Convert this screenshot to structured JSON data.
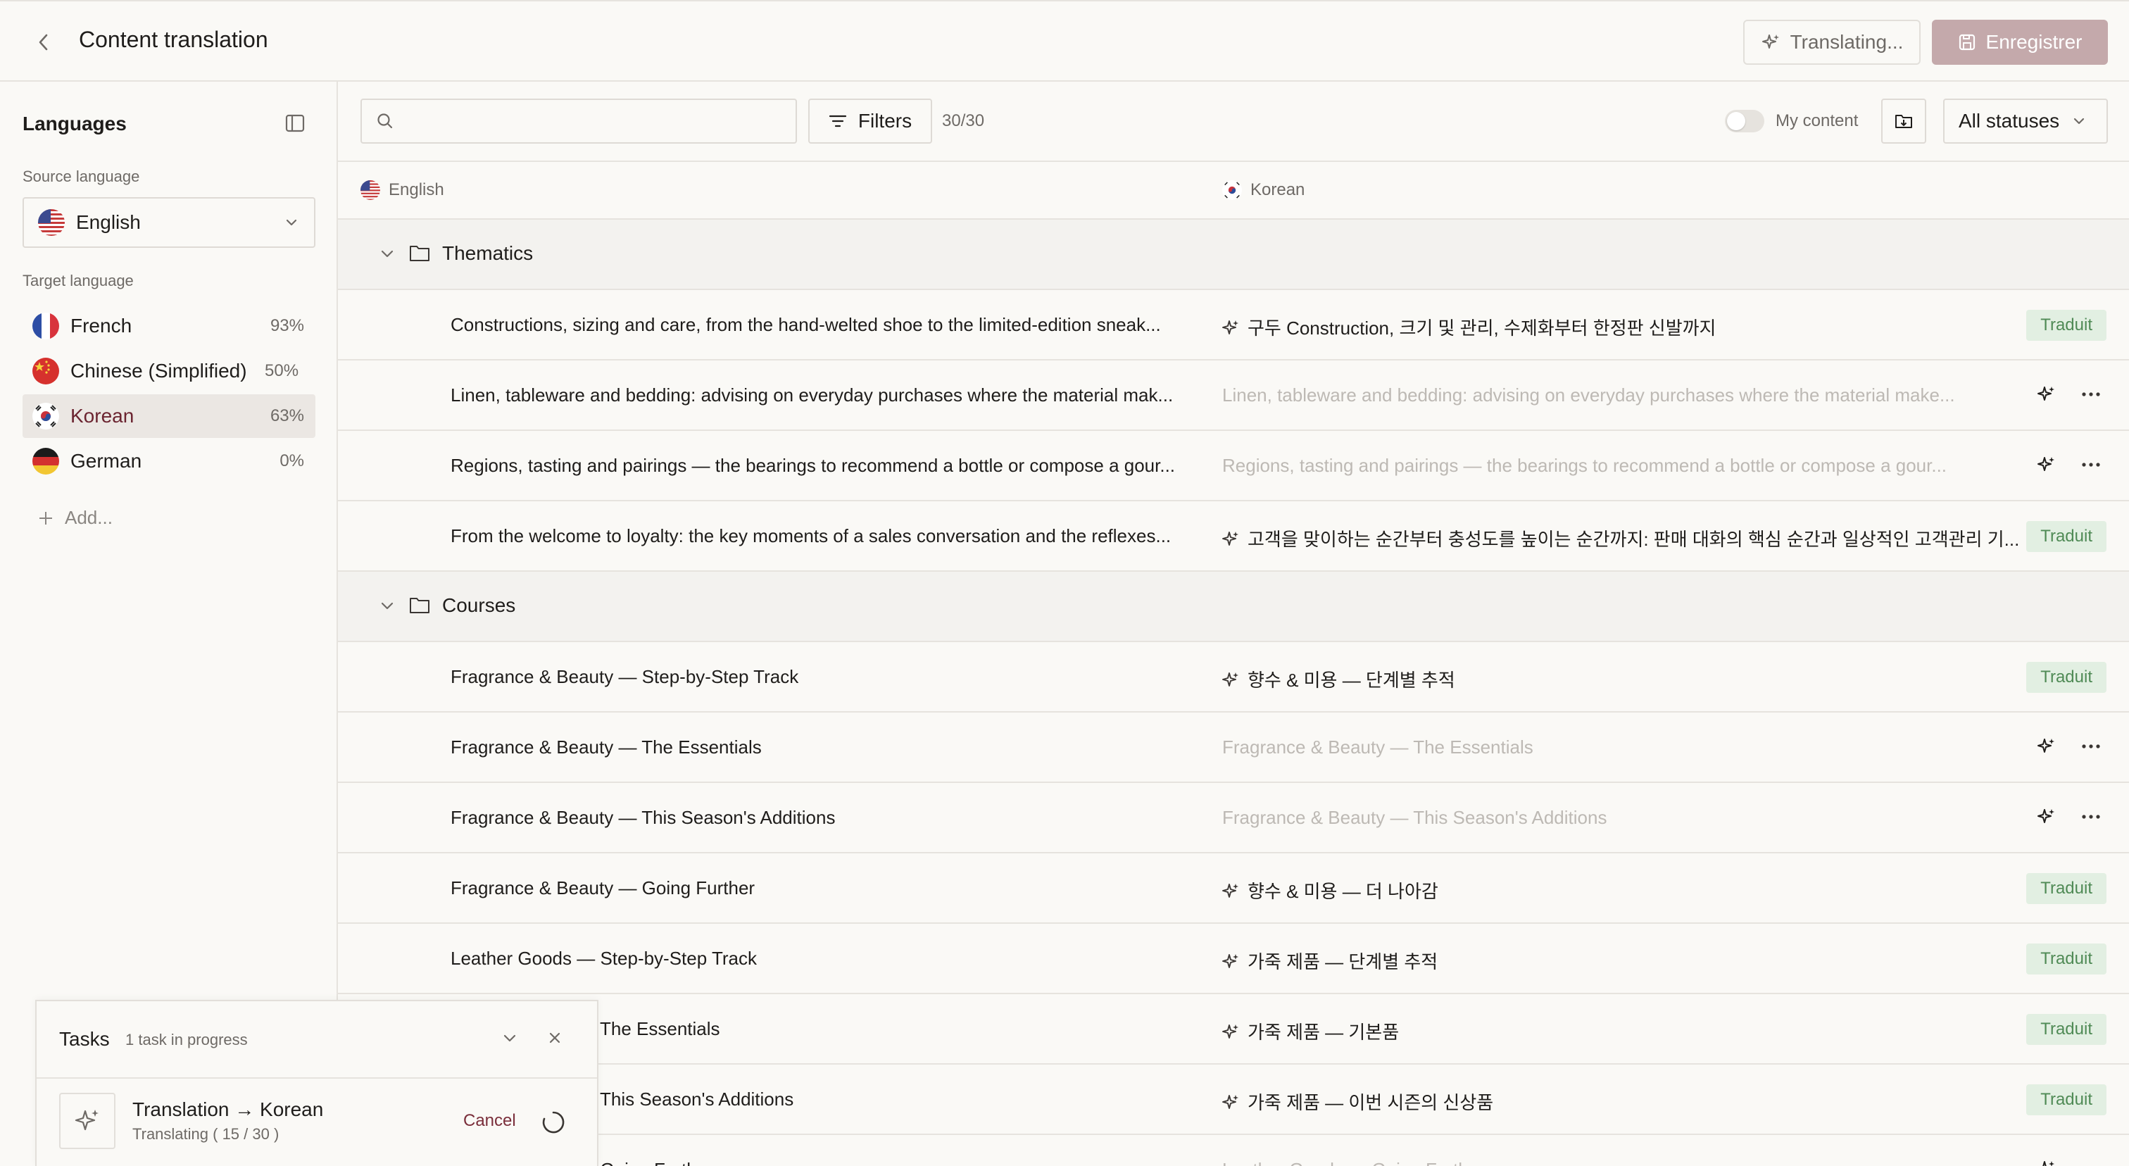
{
  "header": {
    "title": "Content translation",
    "translating_label": "Translating...",
    "save_label": "Enregistrer"
  },
  "sidebar": {
    "title": "Languages",
    "source_label": "Source language",
    "source_value": "English",
    "target_label": "Target language",
    "targets": [
      {
        "name": "French",
        "pct": "93%",
        "flag": "fr-flag-icon"
      },
      {
        "name": "Chinese (Simplified)",
        "pct": "50%",
        "flag": "cn-flag-icon"
      },
      {
        "name": "Korean",
        "pct": "63%",
        "flag": "kr-flag-icon",
        "active": true
      },
      {
        "name": "German",
        "pct": "0%",
        "flag": "de-flag-icon"
      }
    ],
    "add_label": "Add..."
  },
  "toolbar": {
    "search_placeholder": "",
    "filters_label": "Filters",
    "count": "30/30",
    "my_content_label": "My content",
    "status_value": "All statuses"
  },
  "table": {
    "source_header": "English",
    "target_header": "Korean",
    "status_translated": "Traduit",
    "groups": [
      {
        "label": "Thematics",
        "rows": [
          {
            "source": "Constructions, sizing and care, from the hand-welted shoe to the limited-edition sneak...",
            "target": "구두 Construction, 크기 및 관리, 수제화부터 한정판 신발까지",
            "translated": true
          },
          {
            "source": "Linen, tableware and bedding: advising on everyday purchases where the material mak...",
            "target": "Linen, tableware and bedding: advising on everyday purchases where the material make...",
            "translated": false
          },
          {
            "source": "Regions, tasting and pairings — the bearings to recommend a bottle or compose a gour...",
            "target": "Regions, tasting and pairings — the bearings to recommend a bottle or compose a gour...",
            "translated": false
          },
          {
            "source": "From the welcome to loyalty: the key moments of a sales conversation and the reflexes...",
            "target": "고객을 맞이하는 순간부터 충성도를 높이는 순간까지: 판매 대화의 핵심 순간과 일상적인 고객관리 기...",
            "translated": true
          }
        ]
      },
      {
        "label": "Courses",
        "rows": [
          {
            "source": "Fragrance & Beauty — Step-by-Step Track",
            "target": "향수 & 미용 — 단계별 추적",
            "translated": true
          },
          {
            "source": "Fragrance & Beauty — The Essentials",
            "target": "Fragrance & Beauty — The Essentials",
            "translated": false
          },
          {
            "source": "Fragrance & Beauty — This Season's Additions",
            "target": "Fragrance & Beauty — This Season's Additions",
            "translated": false
          },
          {
            "source": "Fragrance & Beauty — Going Further",
            "target": "향수 & 미용 — 더 나아감",
            "translated": true
          },
          {
            "source": "Leather Goods — Step-by-Step Track",
            "target": "가죽 제품 — 단계별 추적",
            "translated": true
          },
          {
            "source": "Leather Goods — The Essentials",
            "target": "가죽 제품 — 기본품",
            "translated": true
          },
          {
            "source": "Leather Goods — This Season's Additions",
            "target": "가죽 제품 — 이번 시즌의 신상품",
            "translated": true
          },
          {
            "source": "Leather Goods — Going Further",
            "target": "Leather Goods — Going Further",
            "translated": false
          }
        ]
      }
    ]
  },
  "tasks": {
    "title": "Tasks",
    "subtitle": "1 task in progress",
    "task_name": "Translation → Korean",
    "task_progress": "Translating ( 15 / 30 )",
    "cancel_label": "Cancel"
  },
  "colors": {
    "accent": "#7a2e3a",
    "save_button": "#c4a9ab",
    "badge_bg": "#e2efe2",
    "badge_text": "#4f8a55"
  }
}
